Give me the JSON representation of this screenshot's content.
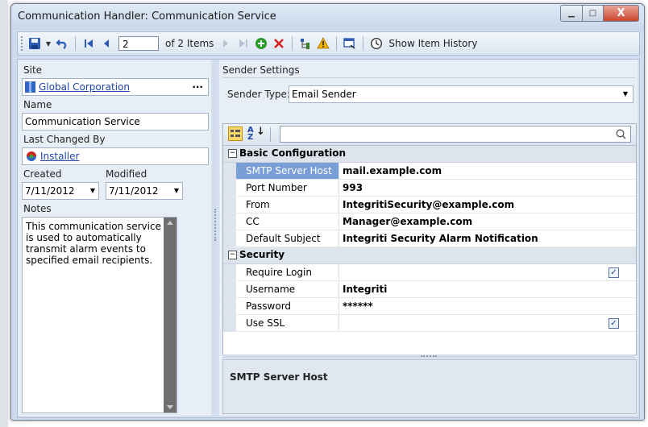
{
  "window": {
    "title": "Communication Handler: Communication Service",
    "minimize": "▁",
    "maximize": "□",
    "close": "X"
  },
  "toolbar": {
    "record_number": "2",
    "record_count": "of 2 Items",
    "show_history": "Show Item History"
  },
  "left": {
    "site_label": "Site",
    "site_value": "Global Corporation",
    "site_more": "···",
    "name_label": "Name",
    "name_value": "Communication Service",
    "changed_label": "Last Changed By",
    "changed_value": "Installer",
    "created_label": "Created",
    "modified_label": "Modified",
    "created_value": "7/11/2012",
    "modified_value": "7/11/2012",
    "notes_label": "Notes",
    "notes_value": "This communication service is used to automatically transmit alarm events to specified email recipients."
  },
  "right": {
    "section_title": "Sender Settings",
    "sender_type_label": "Sender Type:",
    "sender_type_value": "Email Sender",
    "categories": [
      {
        "name": "Basic Configuration",
        "properties": [
          {
            "name": "SMTP Server Host",
            "value": "mail.example.com",
            "selected": true
          },
          {
            "name": "Port Number",
            "value": "993"
          },
          {
            "name": "From",
            "value": "IntegritiSecurity@example.com"
          },
          {
            "name": "CC",
            "value": "Manager@example.com"
          },
          {
            "name": "Default Subject",
            "value": "Integriti Security Alarm Notification"
          }
        ]
      },
      {
        "name": "Security",
        "properties": [
          {
            "name": "Require Login",
            "checked": true
          },
          {
            "name": "Username",
            "value": "Integriti"
          },
          {
            "name": "Password",
            "value": "******"
          },
          {
            "name": "Use SSL",
            "checked": true
          }
        ]
      }
    ],
    "description_title": "SMTP Server Host"
  },
  "colors": {
    "accent": "#7a9fd7",
    "link": "#1f45a8",
    "delete": "#d8231c",
    "add": "#2f9a2c",
    "warning": "#f0b400"
  }
}
